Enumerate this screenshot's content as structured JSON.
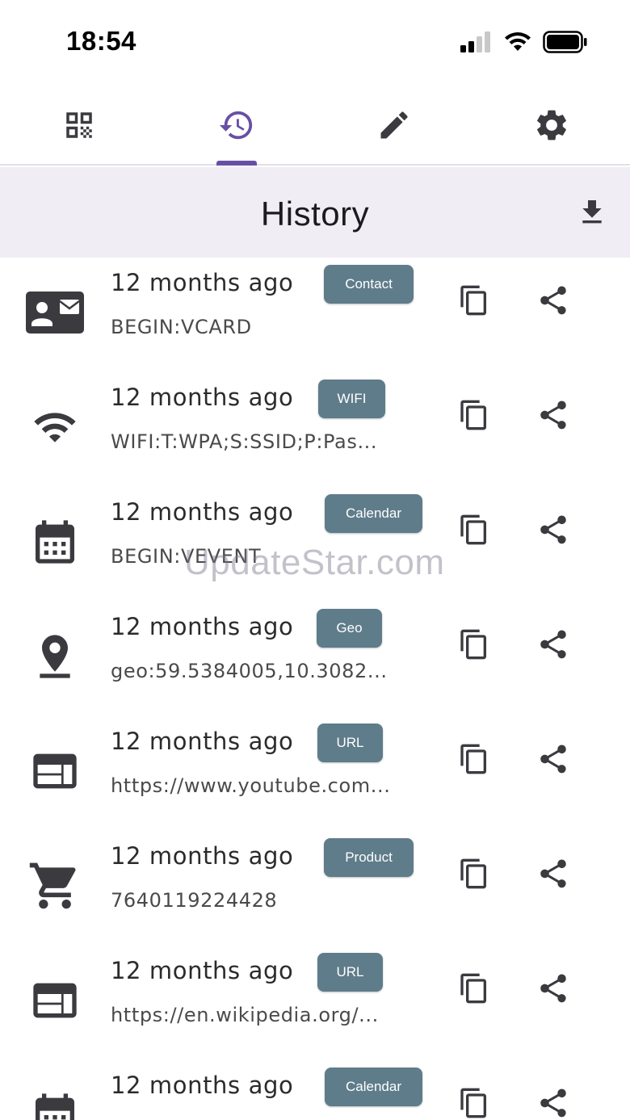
{
  "status_bar": {
    "time": "18:54"
  },
  "tabs": [
    {
      "id": "scan",
      "icon": "qr-code-icon",
      "selected": false
    },
    {
      "id": "history",
      "icon": "history-icon",
      "selected": true
    },
    {
      "id": "create",
      "icon": "pencil-icon",
      "selected": false
    },
    {
      "id": "settings",
      "icon": "gear-icon",
      "selected": false
    }
  ],
  "app_bar": {
    "title": "History",
    "action_icon": "download-icon"
  },
  "colors": {
    "accent": "#6750a4",
    "badge": "#5f7c8a",
    "icon": "#3a3a3f",
    "app_bar_bg": "#f0edf5"
  },
  "history": [
    {
      "time": "12 months ago",
      "type": "Contact",
      "content": "BEGIN:VCARD",
      "icon": "contact-card-icon"
    },
    {
      "time": "12 months ago",
      "type": "WIFI",
      "content": "WIFI:T:WPA;S:SSID;P:Pas...",
      "icon": "wifi-icon"
    },
    {
      "time": "12 months ago",
      "type": "Calendar",
      "content": "BEGIN:VEVENT",
      "icon": "calendar-icon"
    },
    {
      "time": "12 months ago",
      "type": "Geo",
      "content": "geo:59.5384005,10.3082...",
      "icon": "location-pin-icon"
    },
    {
      "time": "12 months ago",
      "type": "URL",
      "content": "https://www.youtube.com...",
      "icon": "web-page-icon"
    },
    {
      "time": "12 months ago",
      "type": "Product",
      "content": "7640119224428",
      "icon": "shopping-cart-icon"
    },
    {
      "time": "12 months ago",
      "type": "URL",
      "content": "https://en.wikipedia.org/...",
      "icon": "web-page-icon"
    },
    {
      "time": "12 months ago",
      "type": "Calendar",
      "content": "",
      "icon": "calendar-icon"
    }
  ],
  "watermark": "UpdateStar.com"
}
